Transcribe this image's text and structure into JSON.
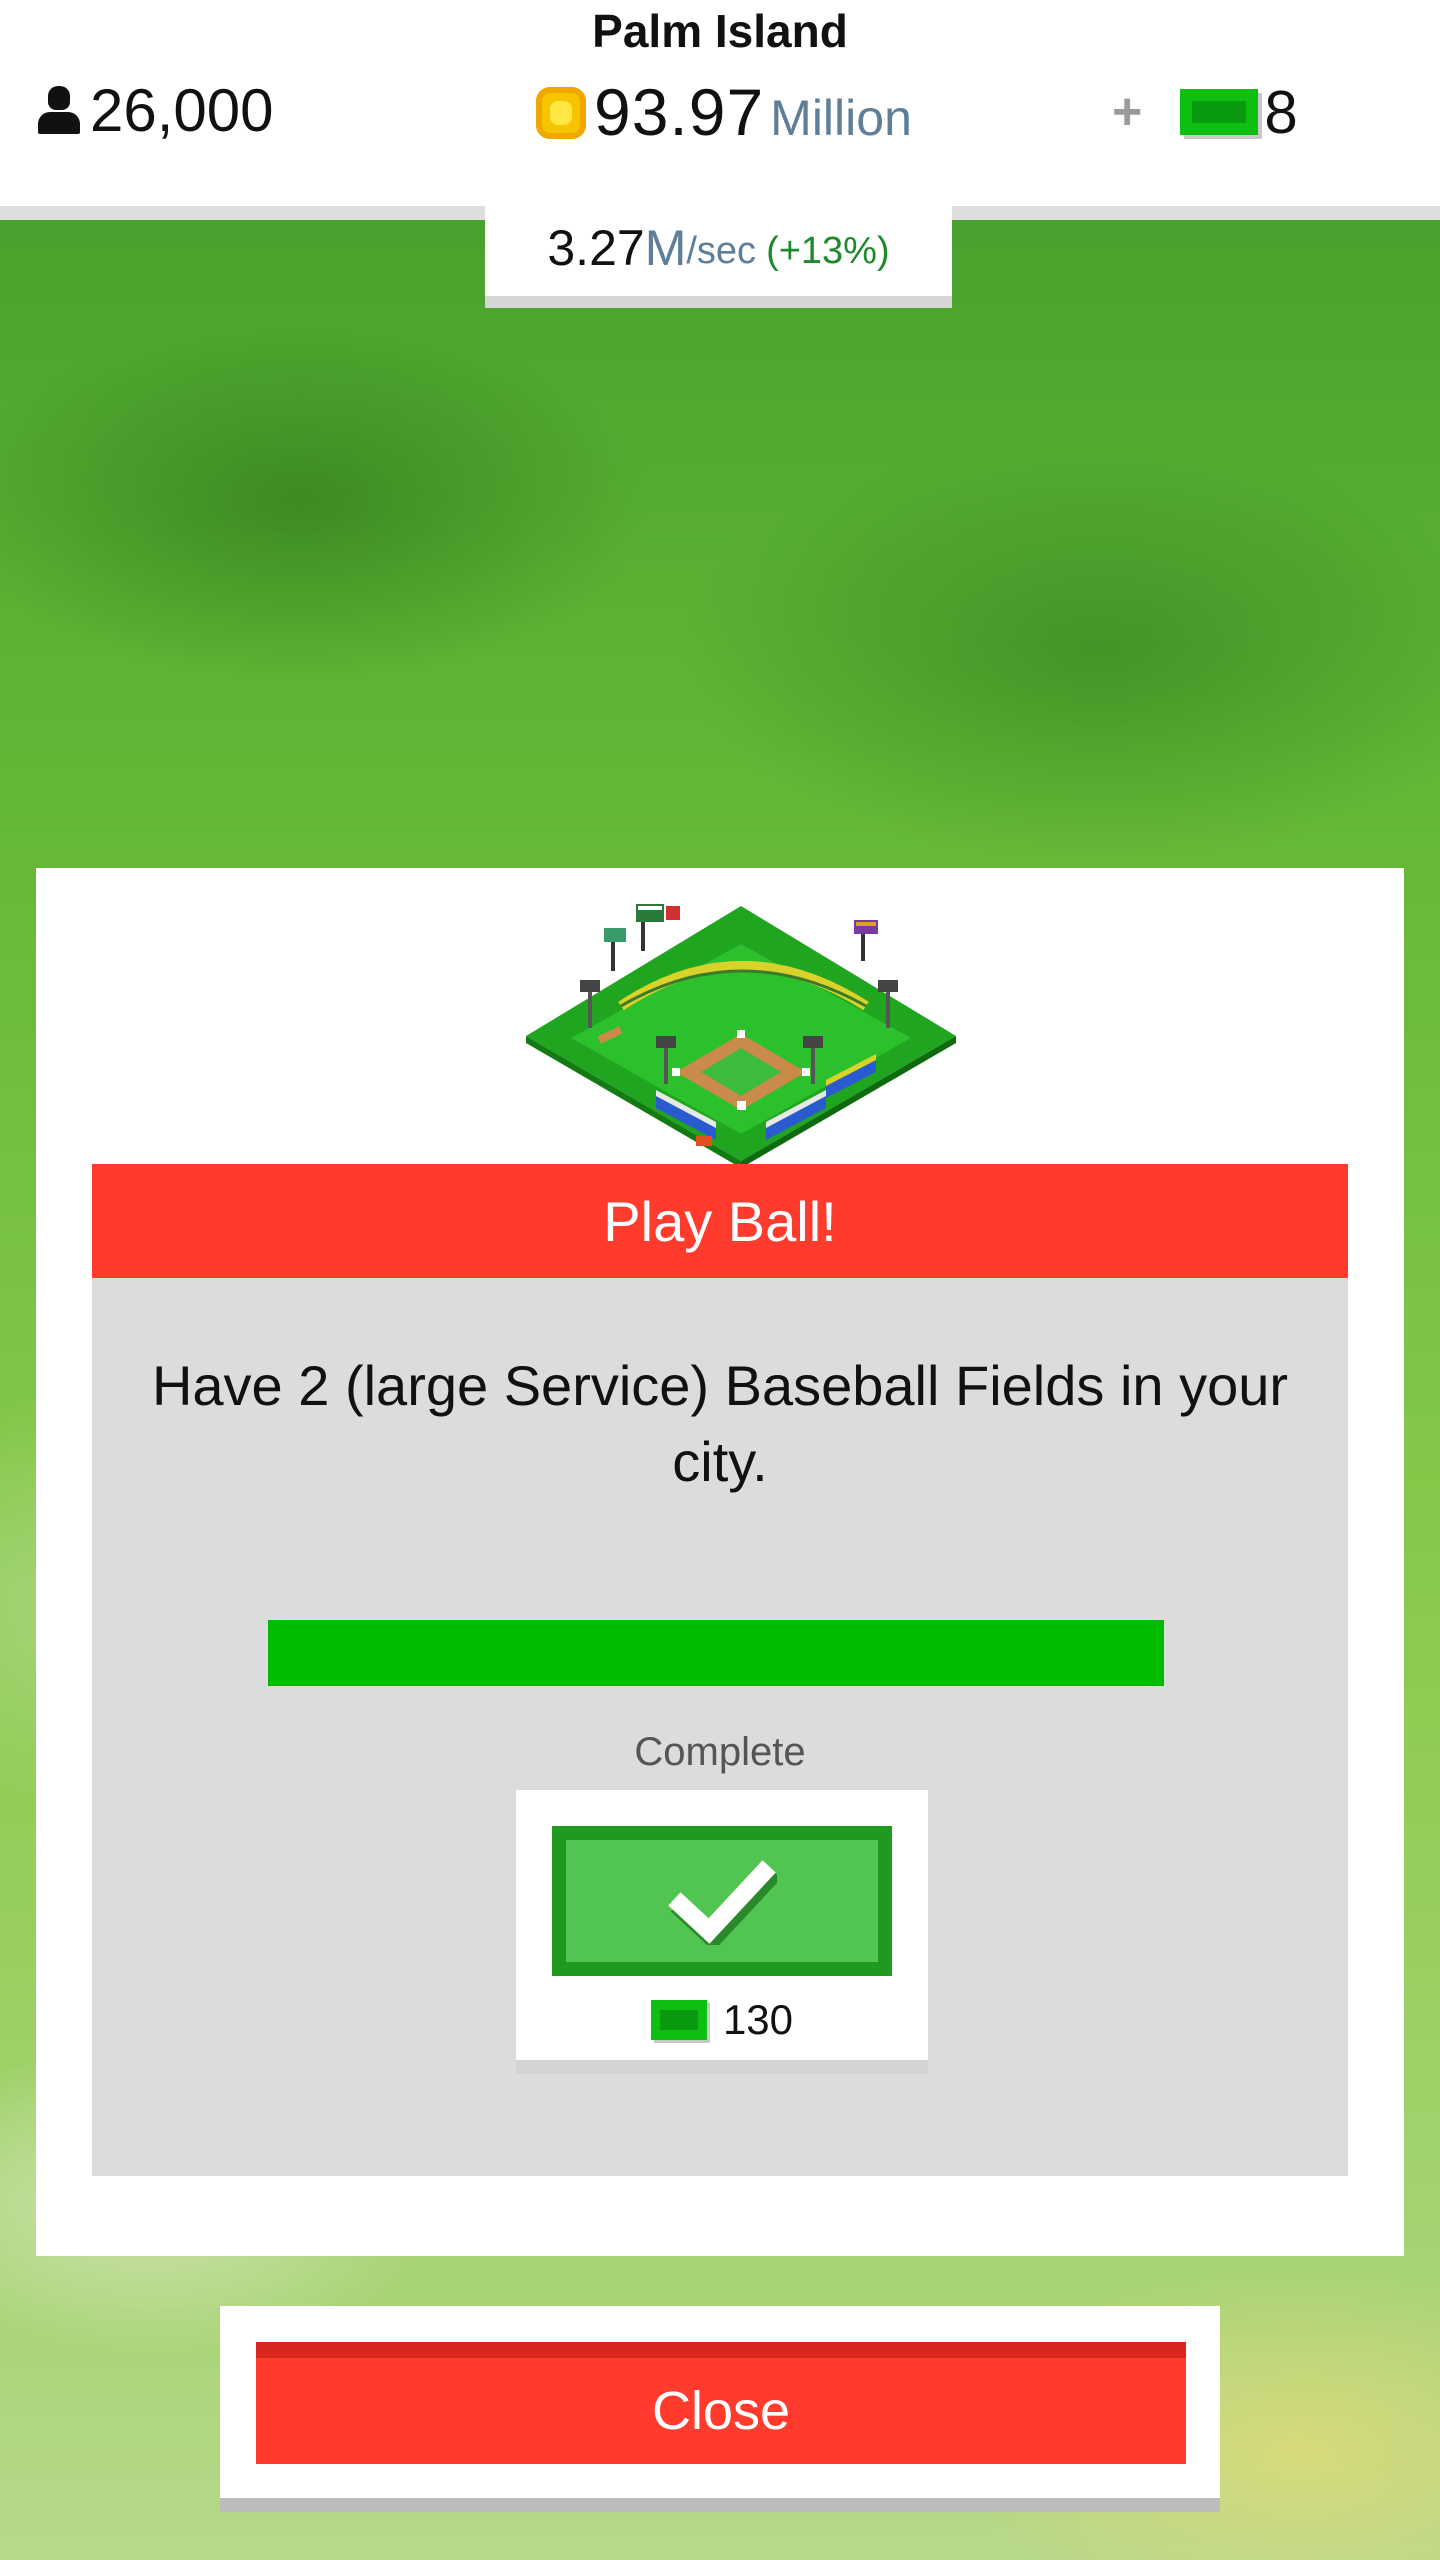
{
  "header": {
    "city_name": "Palm Island",
    "population": "26,000",
    "money_value": "93.97",
    "money_unit": "Million",
    "gems_plus": "+",
    "gems_value": "8",
    "income_rate": "3.27",
    "income_unit": "M",
    "income_per": "/sec",
    "income_pct": "(+13%)"
  },
  "icons": {
    "population": "person-icon",
    "money": "coin-icon",
    "gems": "cash-icon",
    "reward": "cash-icon",
    "check": "checkmark-icon",
    "illustration": "baseball-field-icon"
  },
  "dialog": {
    "title": "Play Ball!",
    "description": "Have 2 (large Service) Baseball Fields in your city.",
    "progress_fraction": 1.0,
    "status": "Complete",
    "reward_value": "130",
    "close_label": "Close"
  },
  "colors": {
    "title_red": "#ff3b2e",
    "progress_green": "#00bb00",
    "check_green": "#52c452",
    "money_unit_blue": "#5e7e99",
    "income_pct_green": "#1f8a2a"
  }
}
